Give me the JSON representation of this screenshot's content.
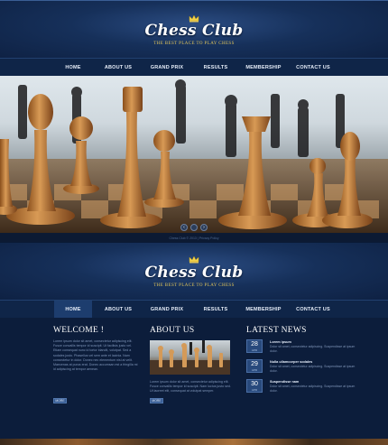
{
  "header": {
    "logo_title": "Chess Club",
    "logo_tagline": "THE BEST PLACE TO PLAY CHESS"
  },
  "nav": {
    "items": [
      {
        "label": "HOME"
      },
      {
        "label": "ABOUT US"
      },
      {
        "label": "GRAND PRIX"
      },
      {
        "label": "RESULTS"
      },
      {
        "label": "MEMBERSHIP"
      },
      {
        "label": "CONTACT US"
      }
    ]
  },
  "hero": {
    "pager": [
      "‹",
      "",
      "›"
    ]
  },
  "copyright": "Chess Club © 2013 | Privacy Policy",
  "welcome": {
    "title": "WELCOME !",
    "text": "Lorem ipsum dolor sit amet, consectetur adipiscing elit. Fusce convallis tempor id suscipit. Ut facilisis justo vel. Etiam consequat nunc id tortor blandit, volutpat. Sed a sodales justo. Phasellus vel sem ante et lacinia. Nam consectetur in dolor. Donec nec elementum nisi at velit. Maecenas at purus erat. Donec accumsan est a fringilla mi id adipiscing at tempor aenean.",
    "more": "MORE"
  },
  "about": {
    "title": "ABOUT US",
    "text": "Lorem ipsum dolor sit amet, consectetur adipiscing elit. Fusce convallis tempor id suscipit. Nam luctus justo sed. Ut laoreet elit, consequat at volutpat semper.",
    "more": "MORE"
  },
  "news": {
    "title": "LATEST NEWS",
    "items": [
      {
        "day": "28",
        "month": "APR",
        "title": "Lorem ipsum",
        "text": "Dolor sit amet, consectetur adipiscing. Suspendisse at ipsum dolor."
      },
      {
        "day": "29",
        "month": "APR",
        "title": "Nulla ullamcorper sodales",
        "text": "Dolor sit amet, consectetur adipiscing. Suspendisse at ipsum dolor."
      },
      {
        "day": "30",
        "month": "APR",
        "title": "Suspendisse nam",
        "text": "Dolor sit amet, consectetur adipiscing. Suspendisse at ipsum dolor."
      }
    ]
  },
  "colors": {
    "background": "#0c1a33",
    "accent": "#e0c45a",
    "nav_active": "#1d3d6e"
  }
}
